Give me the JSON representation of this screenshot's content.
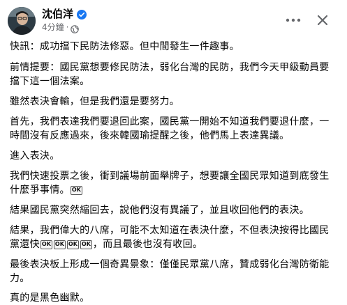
{
  "post": {
    "author": "沈伯洋",
    "time": "4分鐘",
    "separator": "·",
    "paragraphs": [
      {
        "text": "快訊：成功擋下民防法修惡。但中間發生一件趣事。"
      },
      {
        "text": "前情提要：國民黨想要修民防法，弱化台灣的民防，我們今天甲級動員要擋下這一個法案。"
      },
      {
        "text": "雖然表決會輸，但是我們還是要努力。"
      },
      {
        "text": "首先，我們表達我們要退回此案，國民黨一開始不知道我們要退什麼，一時間沒有反應過來，後來韓國瑜提醒之後，他們馬上表達異議。"
      },
      {
        "text": "進入表決。"
      },
      {
        "text": "我們快速投票之後，衝到議場前面舉牌子，想要讓全國民眾知道到底發生什麼爭事情。",
        "emoji": "OK"
      },
      {
        "text": "結果國民黨突然縮回去，說他們沒有異議了，並且收回他們的表決。"
      },
      {
        "text": "結果，我們偉大的八席，可能不太知道在表決什麼，不但表決按得比國民黨還快",
        "emojis": [
          "OK",
          "OK",
          "OK",
          "OK"
        ],
        "tail": "，而且最後也沒有收回。"
      },
      {
        "text": "最後表決板上形成一個奇異景象：僅僅民眾黨八席，贊成弱化台灣防衛能力。"
      },
      {
        "text": "真的是黑色幽默。"
      }
    ]
  },
  "icons": {
    "verified": "verified-badge-icon",
    "globe": "globe-icon",
    "more": "more-options-icon",
    "close": "close-icon"
  },
  "colors": {
    "verified": "#1877f2",
    "meta": "#65676b",
    "text": "#050505"
  }
}
